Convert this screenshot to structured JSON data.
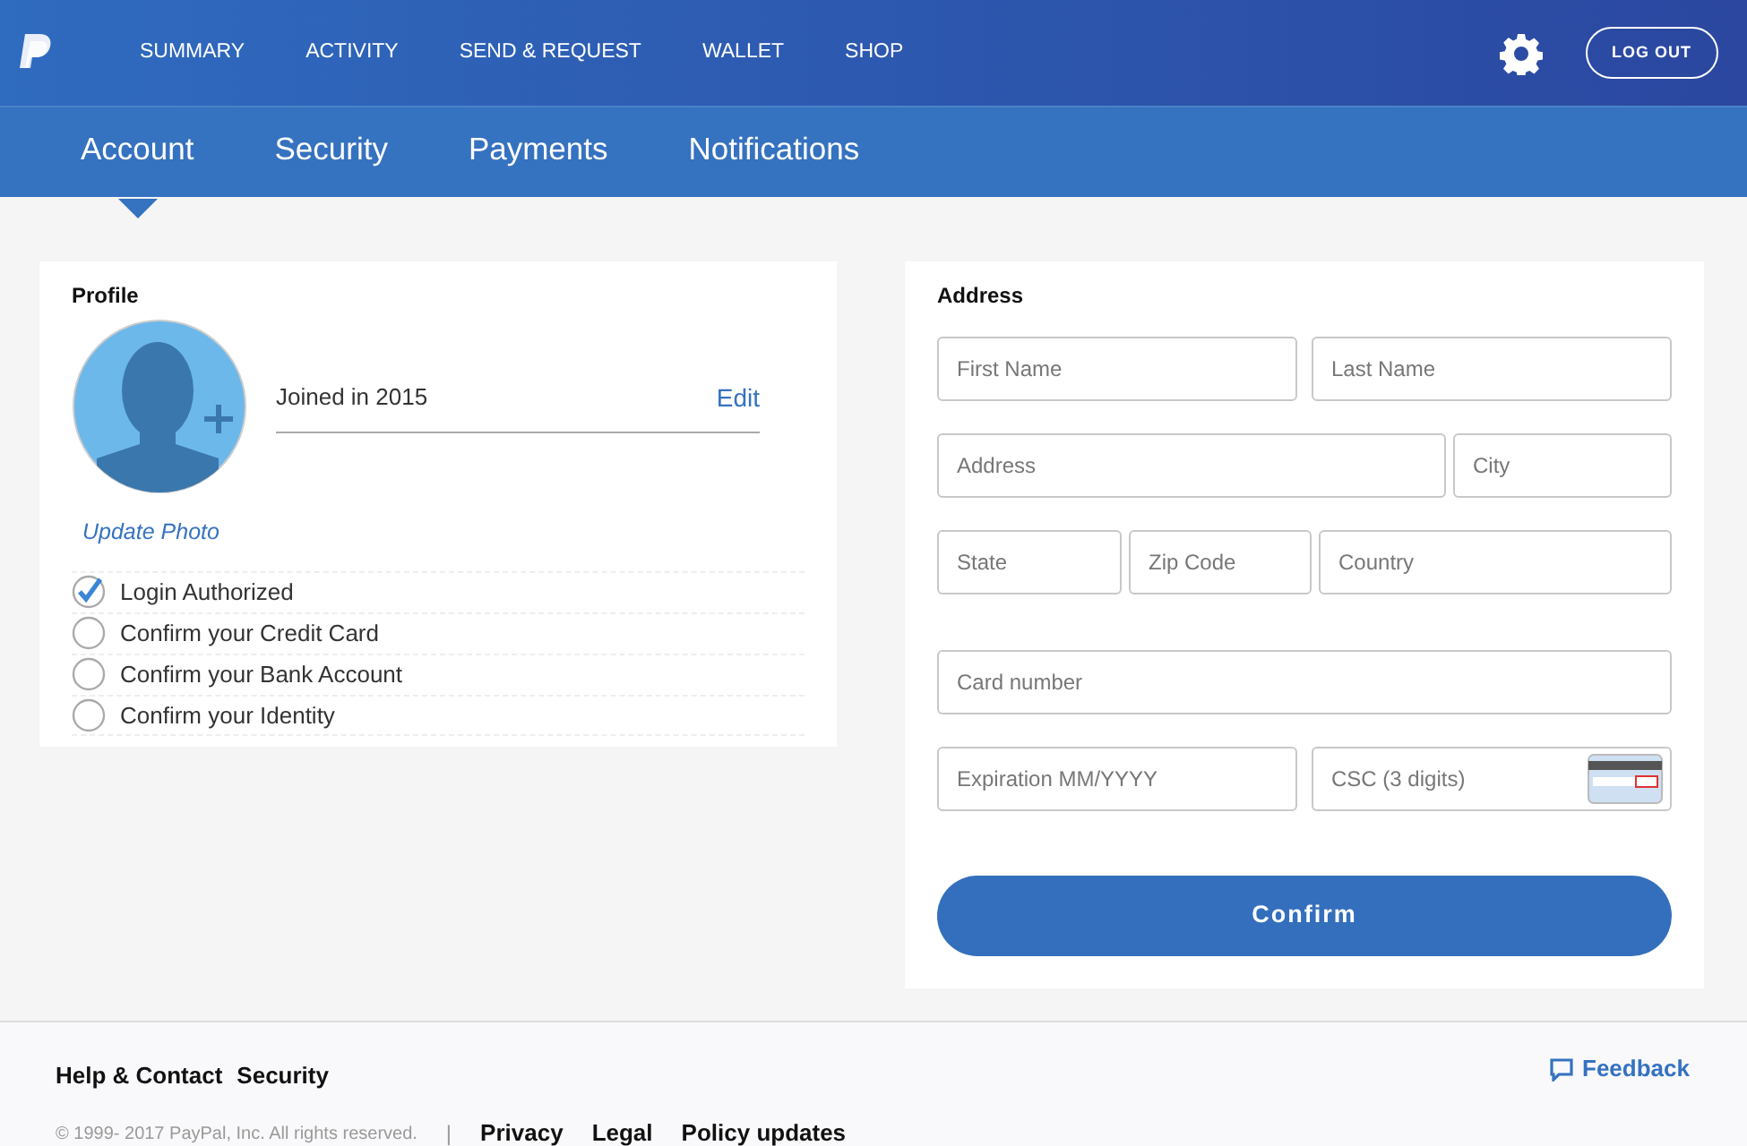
{
  "top_nav": [
    {
      "label": "SUMMARY"
    },
    {
      "label": "ACTIVITY"
    },
    {
      "label": "SEND & REQUEST"
    },
    {
      "label": "WALLET"
    },
    {
      "label": "SHOP"
    }
  ],
  "logout_button": "LOG OUT",
  "tabs": [
    {
      "label": "Account",
      "selected": true
    },
    {
      "label": "Security",
      "selected": false
    },
    {
      "label": "Payments",
      "selected": false
    },
    {
      "label": "Notifications",
      "selected": false
    }
  ],
  "profile": {
    "heading": "Profile",
    "joined": "Joined in 2015",
    "edit": "Edit",
    "update_photo": "Update Photo",
    "checklist": [
      {
        "label": "Login Authorized",
        "checked": true
      },
      {
        "label": "Confirm your Credit Card",
        "checked": false
      },
      {
        "label": "Confirm your Bank Account",
        "checked": false
      },
      {
        "label": "Confirm your Identity",
        "checked": false
      }
    ]
  },
  "address": {
    "heading": "Address",
    "field_rows": [
      [
        {
          "placeholder": "First Name"
        },
        {
          "placeholder": "Last Name"
        }
      ],
      [
        {
          "placeholder": "Address"
        },
        {
          "placeholder": "City"
        }
      ],
      [
        {
          "placeholder": "State"
        },
        {
          "placeholder": "Zip Code"
        },
        {
          "placeholder": "Country"
        }
      ],
      [
        {
          "placeholder": "Card number"
        }
      ],
      [
        {
          "placeholder": "Expiration MM/YYYY"
        },
        {
          "placeholder": "CSC (3 digits)",
          "kind": "csc"
        }
      ]
    ],
    "confirm_button": "Confirm"
  },
  "footer": {
    "links": [
      "Help & Contact",
      "Security"
    ],
    "copyright": "© 1999- 2017 PayPal, Inc. All rights reserved.",
    "separator": "|",
    "legal_links": [
      "Privacy",
      "Legal",
      "Policy updates"
    ],
    "feedback": "Feedback"
  }
}
